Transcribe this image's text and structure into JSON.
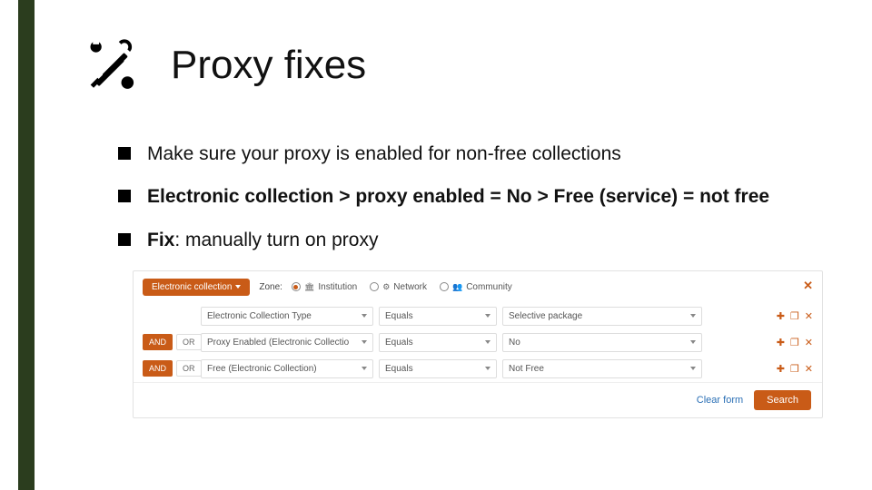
{
  "title": "Proxy fixes",
  "bullets": {
    "b1": "Make sure your proxy is enabled for non-free collections",
    "b2_html": "Electronic collection > proxy enabled = No > Free (service) = not free",
    "b3_prefix": "Fix",
    "b3_rest": ": manually turn on proxy"
  },
  "form": {
    "entity": "Electronic collection",
    "zone_label": "Zone:",
    "zone_options": {
      "institution": "Institution",
      "network": "Network",
      "community": "Community"
    },
    "rows": [
      {
        "field": "Electronic Collection Type",
        "operator": "Equals",
        "value": "Selective package",
        "and": true
      },
      {
        "field": "Proxy Enabled (Electronic Collectio",
        "operator": "Equals",
        "value": "No",
        "and": true
      },
      {
        "field": "Free (Electronic Collection)",
        "operator": "Equals",
        "value": "Not Free",
        "and": true
      }
    ],
    "logic": {
      "and": "AND",
      "or": "OR"
    },
    "clear": "Clear form",
    "search": "Search"
  }
}
